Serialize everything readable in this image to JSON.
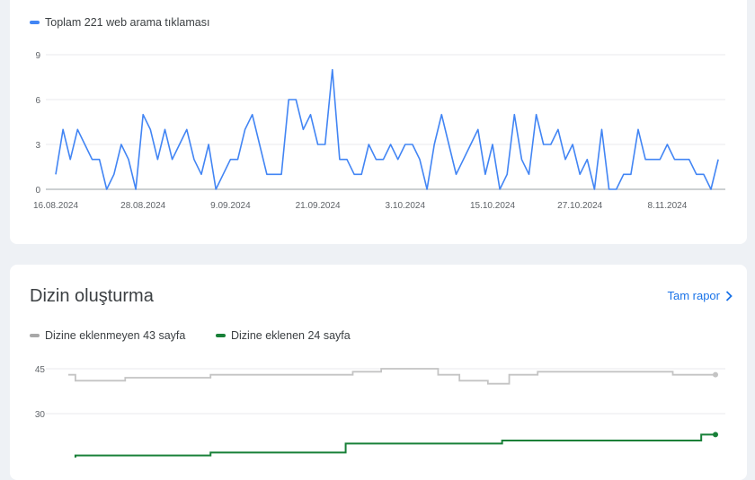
{
  "performance": {
    "legend": {
      "label": "Toplam 221 web arama tıklaması",
      "color": "#4285f4"
    }
  },
  "indexing": {
    "title": "Dizin oluşturma",
    "full_report": "Tam rapor",
    "legend": [
      {
        "label": "Dizine eklenmeyen 43 sayfa",
        "color": "#a8a8a8"
      },
      {
        "label": "Dizine eklenen 24 sayfa",
        "color": "#188038"
      }
    ]
  },
  "chart_data": [
    {
      "type": "line",
      "yticks": [
        "0",
        "3",
        "6",
        "9"
      ],
      "ylim": [
        0,
        9
      ],
      "xticks": [
        "16.08.2024",
        "28.08.2024",
        "9.09.2024",
        "21.09.2024",
        "3.10.2024",
        "15.10.2024",
        "27.10.2024",
        "8.11.2024"
      ],
      "series": [
        {
          "name": "Toplam 221 web arama tıklaması",
          "color": "#4285f4",
          "values": [
            1,
            4,
            2,
            4,
            3,
            2,
            2,
            0,
            1,
            3,
            2,
            0,
            5,
            4,
            2,
            4,
            2,
            3,
            4,
            2,
            1,
            3,
            0,
            1,
            2,
            2,
            4,
            5,
            3,
            1,
            1,
            1,
            6,
            6,
            4,
            5,
            3,
            3,
            8,
            2,
            2,
            1,
            1,
            3,
            2,
            2,
            3,
            2,
            3,
            3,
            2,
            0,
            3,
            5,
            3,
            1,
            2,
            3,
            4,
            1,
            3,
            0,
            1,
            5,
            2,
            1,
            5,
            3,
            3,
            4,
            2,
            3,
            1,
            2,
            0,
            4,
            0,
            0,
            1,
            1,
            4,
            2,
            2,
            2,
            3,
            2,
            2,
            2,
            1,
            1,
            0,
            2
          ]
        }
      ]
    },
    {
      "type": "line",
      "yticks": [
        "30",
        "45"
      ],
      "ylim": [
        15,
        45
      ],
      "series": [
        {
          "name": "Dizine eklenmeyen 43 sayfa",
          "color": "#c4c4c4",
          "values": [
            43,
            41,
            41,
            41,
            41,
            41,
            41,
            41,
            42,
            42,
            42,
            42,
            42,
            42,
            42,
            42,
            42,
            42,
            42,
            42,
            43,
            43,
            43,
            43,
            43,
            43,
            43,
            43,
            43,
            43,
            43,
            43,
            43,
            43,
            43,
            43,
            43,
            43,
            43,
            43,
            44,
            44,
            44,
            44,
            45,
            45,
            45,
            45,
            45,
            45,
            45,
            45,
            43,
            43,
            43,
            41,
            41,
            41,
            41,
            40,
            40,
            40,
            43,
            43,
            43,
            43,
            44,
            44,
            44,
            44,
            44,
            44,
            44,
            44,
            44,
            44,
            44,
            44,
            44,
            44,
            44,
            44,
            44,
            44,
            44,
            43,
            43,
            43,
            43,
            43,
            43,
            43
          ]
        },
        {
          "name": "Dizine eklenen 24 sayfa",
          "color": "#188038",
          "values": [
            15,
            16,
            16,
            16,
            16,
            16,
            16,
            16,
            16,
            16,
            16,
            16,
            16,
            16,
            16,
            16,
            16,
            16,
            16,
            16,
            17,
            17,
            17,
            17,
            17,
            17,
            17,
            17,
            17,
            17,
            17,
            17,
            17,
            17,
            17,
            17,
            17,
            17,
            17,
            20,
            20,
            20,
            20,
            20,
            20,
            20,
            20,
            20,
            20,
            20,
            20,
            20,
            20,
            20,
            20,
            20,
            20,
            20,
            20,
            20,
            20,
            21,
            21,
            21,
            21,
            21,
            21,
            21,
            21,
            21,
            21,
            21,
            21,
            21,
            21,
            21,
            21,
            21,
            21,
            21,
            21,
            21,
            21,
            21,
            21,
            21,
            21,
            21,
            21,
            23,
            23,
            23
          ]
        }
      ]
    }
  ]
}
